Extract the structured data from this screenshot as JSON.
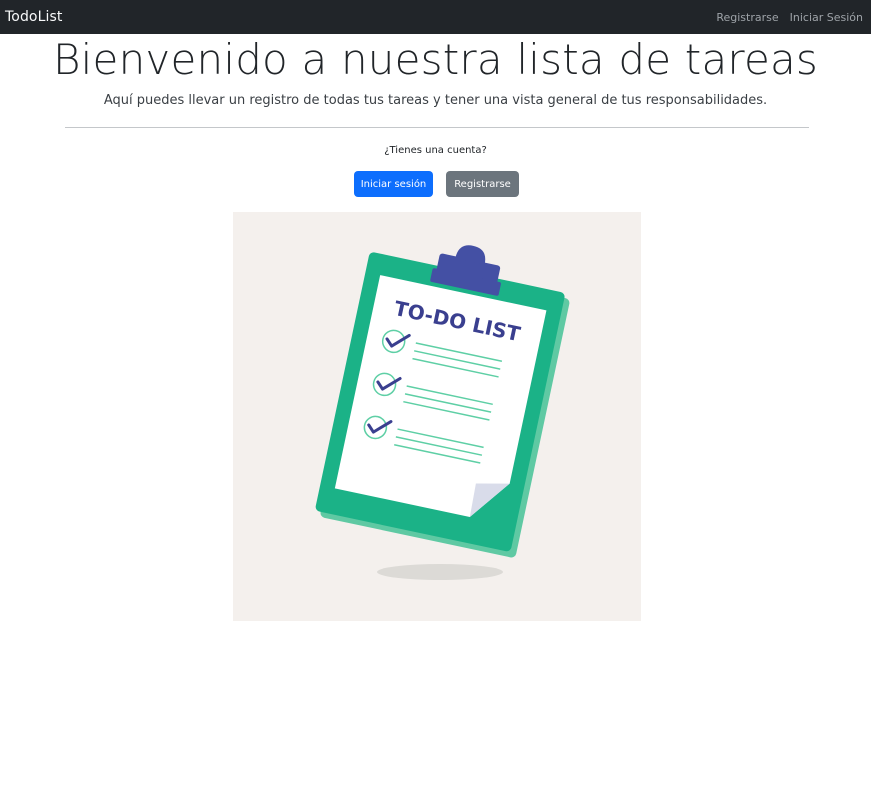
{
  "navbar": {
    "brand": "TodoList",
    "links": [
      {
        "label": "Registrarse"
      },
      {
        "label": "Iniciar Sesión"
      }
    ]
  },
  "hero": {
    "title": "Bienvenido a nuestra lista de tareas",
    "lead": "Aquí puedes llevar un registro de todas tus tareas y tener una vista general de tus responsabilidades.",
    "question": "¿Tienes una cuenta?",
    "login_button": "Iniciar sesión",
    "register_button": "Registrarse"
  },
  "illustration": {
    "heading": "TO-DO LIST",
    "colors": {
      "background": "#f4f0ed",
      "board": "#1bb287",
      "clip": "#4450a4",
      "check": "#3a3f8f",
      "line": "#5ecfa5"
    }
  },
  "colors": {
    "navbar": "#212529",
    "primary": "#0d6efd",
    "secondary": "#6c757d"
  }
}
